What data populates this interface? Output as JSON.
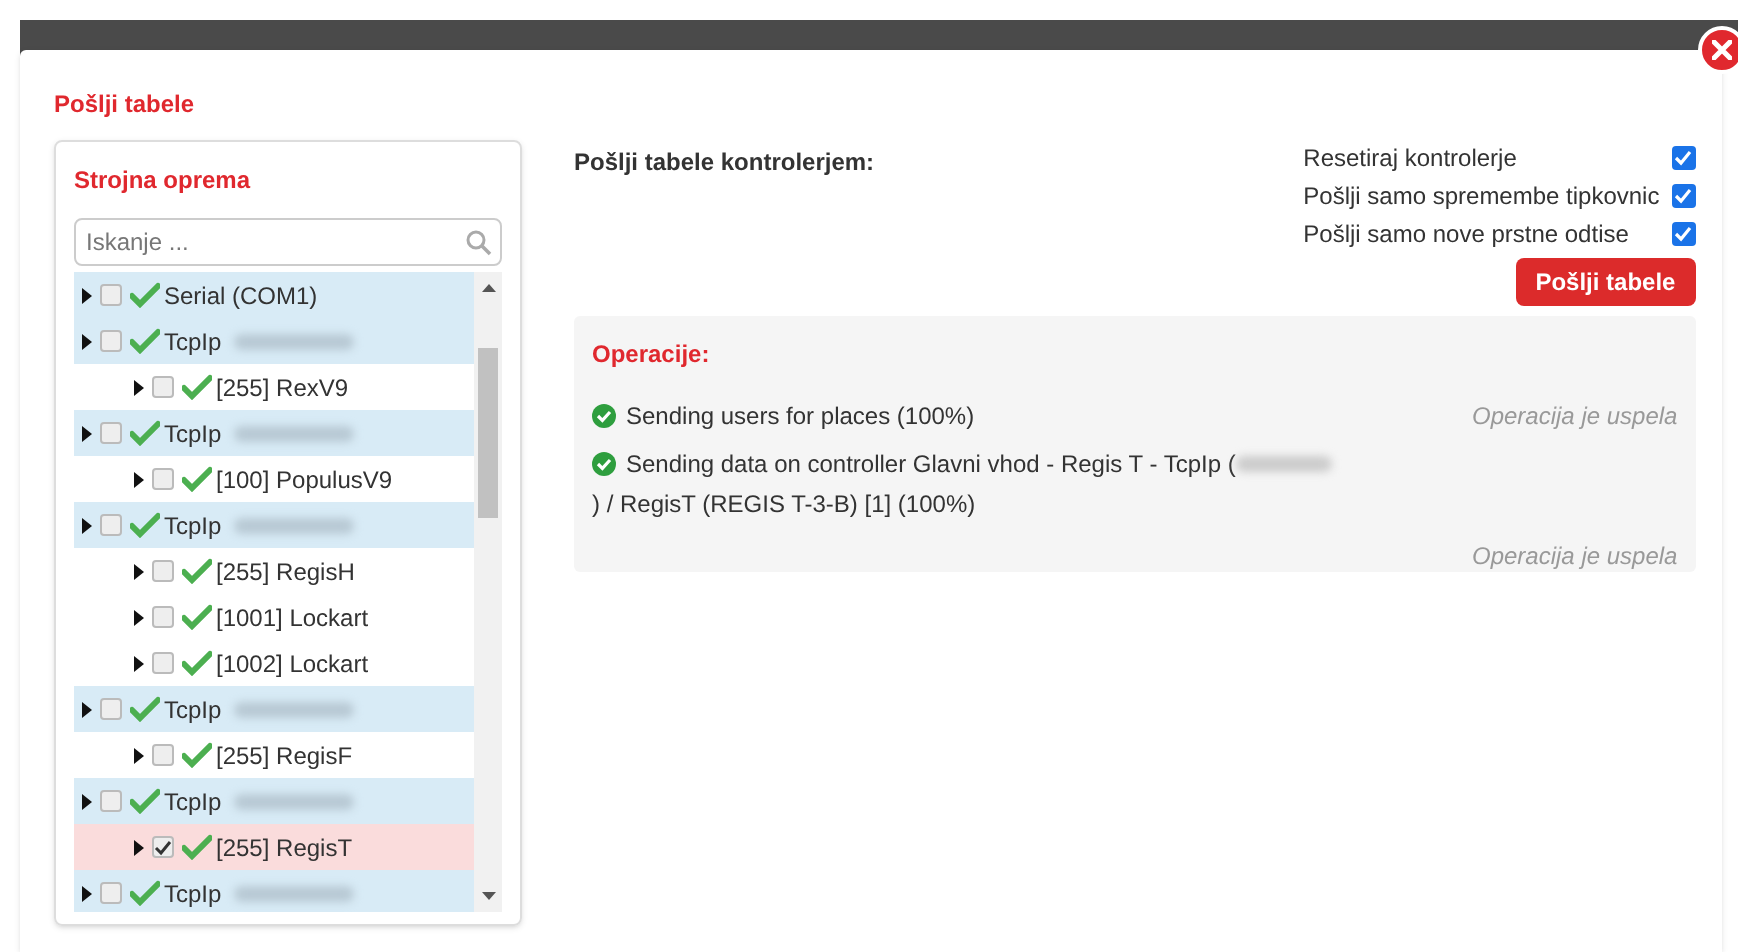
{
  "dialog": {
    "title": "Pošlji tabele"
  },
  "hardware": {
    "title": "Strojna oprema",
    "search": {
      "placeholder": "Iskanje ..."
    },
    "tree": [
      {
        "label": "Serial (COM1)",
        "checked": false,
        "selected": false,
        "redacted": false
      },
      {
        "label": "TcpIp",
        "checked": false,
        "selected": false,
        "redacted": true,
        "children": [
          {
            "label": "[255] RexV9",
            "checked": false,
            "selected": false
          }
        ]
      },
      {
        "label": "TcpIp",
        "checked": false,
        "selected": false,
        "redacted": true,
        "children": [
          {
            "label": "[100] PopulusV9",
            "checked": false,
            "selected": false
          }
        ]
      },
      {
        "label": "TcpIp",
        "checked": false,
        "selected": false,
        "redacted": true,
        "children": [
          {
            "label": "[255] RegisH",
            "checked": false,
            "selected": false
          },
          {
            "label": "[1001] Lockart",
            "checked": false,
            "selected": false
          },
          {
            "label": "[1002] Lockart",
            "checked": false,
            "selected": false
          }
        ]
      },
      {
        "label": "TcpIp",
        "checked": false,
        "selected": false,
        "redacted": true,
        "children": [
          {
            "label": "[255] RegisF",
            "checked": false,
            "selected": false
          }
        ]
      },
      {
        "label": "TcpIp",
        "checked": false,
        "selected": false,
        "redacted": true,
        "children": [
          {
            "label": "[255] RegisT",
            "checked": true,
            "selected": true
          }
        ]
      },
      {
        "label": "TcpIp",
        "checked": false,
        "selected": false,
        "redacted": true
      }
    ]
  },
  "send": {
    "heading": "Pošlji tabele kontrolerjem:",
    "options": [
      {
        "label": "Resetiraj kontrolerje",
        "checked": true
      },
      {
        "label": "Pošlji samo spremembe tipkovnic",
        "checked": true
      },
      {
        "label": "Pošlji samo nove prstne odtise",
        "checked": true
      }
    ],
    "button": "Pošlji tabele"
  },
  "operations": {
    "title": "Operacije:",
    "items": [
      {
        "text_before": "Sending users for places (100%)",
        "status": "Operacija je uspela",
        "redacted": false
      },
      {
        "text_before": "Sending data on controller Glavni vhod - Regis T - TcpIp (",
        "text_after": ") / RegisT (REGIS T-3-B) [1] (100%)",
        "status": "Operacija je uspela",
        "redacted": true
      }
    ]
  }
}
